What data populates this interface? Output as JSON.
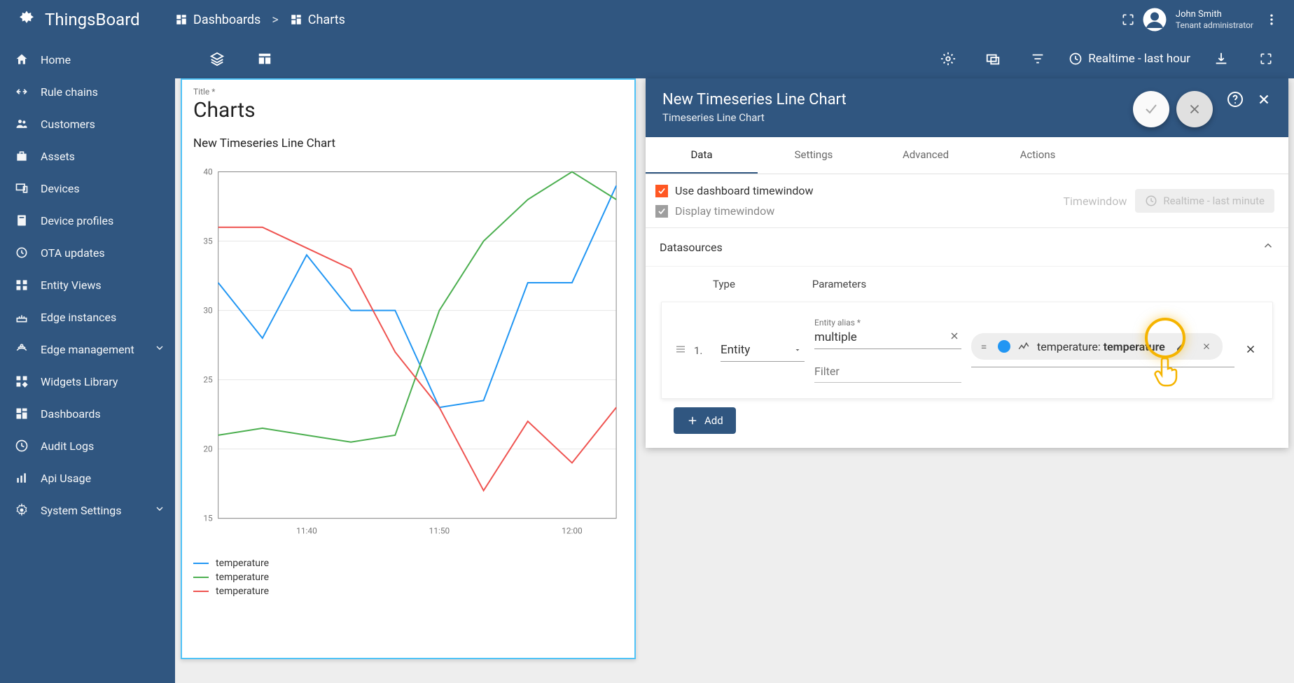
{
  "app": "ThingsBoard",
  "breadcrumb": {
    "root": "Dashboards",
    "sep": ">",
    "current": "Charts"
  },
  "user": {
    "name": "John Smith",
    "role": "Tenant administrator"
  },
  "sidebar": {
    "items": [
      {
        "label": "Home"
      },
      {
        "label": "Rule chains"
      },
      {
        "label": "Customers"
      },
      {
        "label": "Assets"
      },
      {
        "label": "Devices"
      },
      {
        "label": "Device profiles"
      },
      {
        "label": "OTA updates"
      },
      {
        "label": "Entity Views"
      },
      {
        "label": "Edge instances"
      },
      {
        "label": "Edge management"
      },
      {
        "label": "Widgets Library"
      },
      {
        "label": "Dashboards"
      },
      {
        "label": "Audit Logs"
      },
      {
        "label": "Api Usage"
      },
      {
        "label": "System Settings"
      }
    ]
  },
  "toolbar": {
    "realtime": "Realtime - last hour"
  },
  "widget": {
    "title_label": "Title *",
    "title": "Charts",
    "chart_title": "New Timeseries Line Chart"
  },
  "chart_data": {
    "type": "line",
    "xlabel": "",
    "ylabel": "",
    "ylim": [
      15,
      40
    ],
    "yticks": [
      15,
      20,
      25,
      30,
      35,
      40
    ],
    "xticks": [
      "11:40",
      "11:50",
      "12:00"
    ],
    "series": [
      {
        "name": "temperature",
        "color": "#2196f3",
        "values": [
          32,
          28,
          34,
          30,
          30,
          23,
          23.5,
          32,
          32,
          39
        ]
      },
      {
        "name": "temperature",
        "color": "#4caf50",
        "values": [
          21,
          21.5,
          21,
          20.5,
          21,
          30,
          35,
          38,
          40,
          38
        ]
      },
      {
        "name": "temperature",
        "color": "#ef5350",
        "values": [
          36,
          36,
          34.5,
          33,
          27,
          23,
          17,
          22,
          19,
          23
        ]
      }
    ]
  },
  "panel": {
    "title": "New Timeseries Line Chart",
    "subtitle": "Timeseries Line Chart",
    "tabs": [
      "Data",
      "Settings",
      "Advanced",
      "Actions"
    ],
    "active_tab": "Data",
    "use_dashboard_tw": "Use dashboard timewindow",
    "display_tw": "Display timewindow",
    "timewindow_label": "Timewindow",
    "timewindow_chip": "Realtime - last minute",
    "datasources_label": "Datasources",
    "col_type": "Type",
    "col_params": "Parameters",
    "row_index": "1.",
    "entity_label": "Entity",
    "alias_label": "Entity alias *",
    "alias_value": "multiple",
    "filter_placeholder": "Filter",
    "chip_key": "temperature:",
    "chip_val": "temperature",
    "add_label": "Add"
  }
}
